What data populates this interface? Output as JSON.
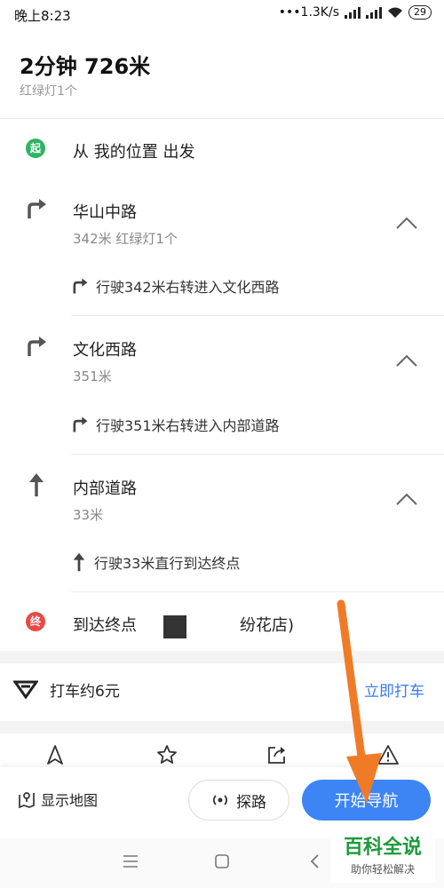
{
  "status_bar": {
    "time": "晚上8:23",
    "speed": "•••1.3K/s",
    "battery": "29"
  },
  "summary": {
    "title": "2分钟  726米",
    "subtitle": "红绿灯1个"
  },
  "route": {
    "start": {
      "badge": "起",
      "text": "从  我的位置  出发"
    },
    "steps": [
      {
        "name": "华山中路",
        "info": "342米  红绿灯1个",
        "detail": "行驶342米右转进入文化西路",
        "icon": "turn-right-icon"
      },
      {
        "name": "文化西路",
        "info": "351米",
        "detail": "行驶351米右转进入内部道路",
        "icon": "turn-right-icon"
      },
      {
        "name": "内部道路",
        "info": "33米",
        "detail": "行驶33米直行到达终点",
        "icon": "straight-icon"
      }
    ],
    "end": {
      "badge": "终",
      "text": "到达终点",
      "text_suffix": "纷花店)"
    }
  },
  "taxi": {
    "text": "打车约6元",
    "link": "立即打车"
  },
  "bottom": {
    "show_map": "显示地图",
    "probe": "探路",
    "start": "开始导航"
  },
  "watermark": {
    "big": "百科全说",
    "small": "助你轻松解决"
  },
  "colors": {
    "start_badge": "#2fb463",
    "end_badge": "#e84a4a",
    "accent": "#3d85f5",
    "arrow": "#f07b26"
  }
}
